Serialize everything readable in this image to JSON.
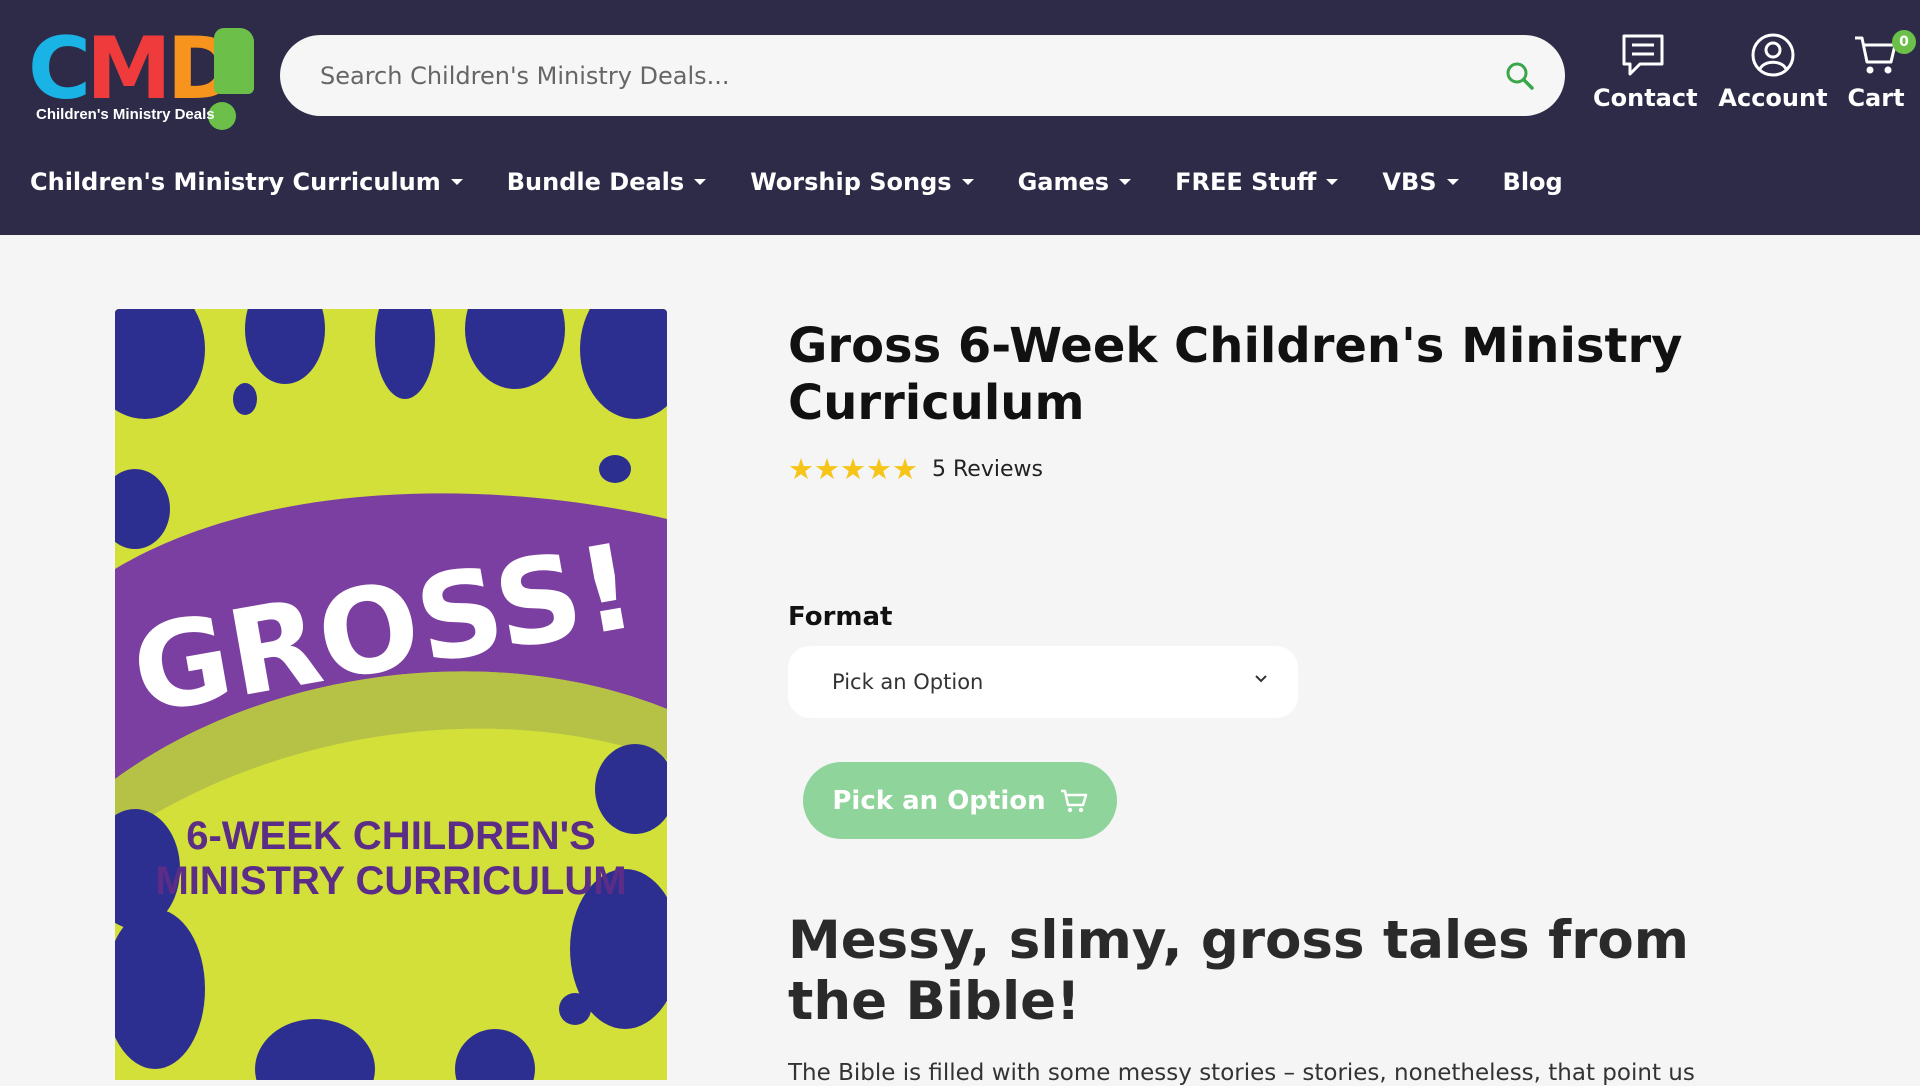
{
  "brand": {
    "logo_word": [
      "C",
      "M",
      "D"
    ],
    "tagline": "Children's Ministry Deals",
    "colors": {
      "header_bg": "#2d2b48",
      "accent_green": "#6cc04a",
      "cta": "#8fd49a"
    }
  },
  "search": {
    "placeholder": "Search Children's Ministry Deals...",
    "icon": "search-icon"
  },
  "header_actions": [
    {
      "label": "Contact",
      "icon": "chat-icon"
    },
    {
      "label": "Account",
      "icon": "user-icon"
    },
    {
      "label": "Cart",
      "icon": "cart-icon",
      "badge": "0"
    }
  ],
  "nav": [
    {
      "label": "Children's Ministry Curriculum",
      "dropdown": true
    },
    {
      "label": "Bundle Deals",
      "dropdown": true
    },
    {
      "label": "Worship Songs",
      "dropdown": true
    },
    {
      "label": "Games",
      "dropdown": true
    },
    {
      "label": "FREE Stuff",
      "dropdown": true
    },
    {
      "label": "VBS",
      "dropdown": true
    },
    {
      "label": "Blog",
      "dropdown": false
    }
  ],
  "product": {
    "image": {
      "title": "GROSS!",
      "subtitle_line1": "6-WEEK CHILDREN'S",
      "subtitle_line2": "MINISTRY CURRICULUM"
    },
    "title": "Gross 6-Week Children's Ministry Curriculum",
    "rating": 5,
    "stars": "★★★★★",
    "reviews_label": "5 Reviews",
    "format_label": "Format",
    "format_selected": "Pick an Option",
    "cta_label": "Pick an Option",
    "headline": "Messy, slimy, gross tales from the Bible!",
    "body_start": "The Bible is filled with some messy stories – stories, nonetheless, that point us"
  }
}
